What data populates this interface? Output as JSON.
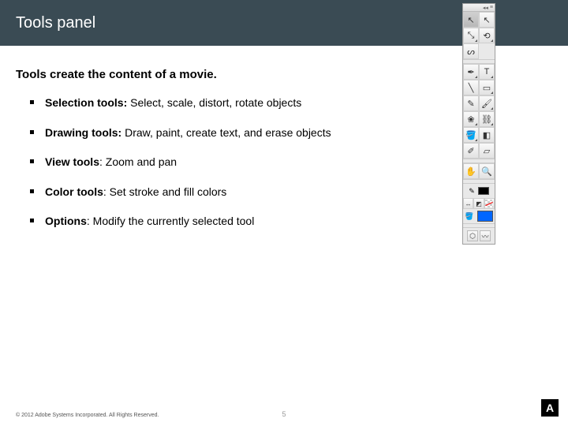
{
  "header": {
    "title": "Tools panel"
  },
  "intro": "Tools create the content of a movie.",
  "bullets": [
    {
      "label": "Selection tools:",
      "desc": " Select, scale, distort, rotate objects"
    },
    {
      "label": "Drawing tools:",
      "desc": " Draw, paint, create text, and erase objects"
    },
    {
      "label": "View tools",
      "desc": ": Zoom and pan"
    },
    {
      "label": "Color tools",
      "desc": ": Set stroke and fill colors"
    },
    {
      "label": "Options",
      "desc": ": Modify the currently selected tool"
    }
  ],
  "footer": {
    "copyright": "© 2012 Adobe Systems Incorporated. All Rights Reserved.",
    "page": "5",
    "logo": "A"
  },
  "tools": {
    "grip": {
      "collapse": "◂◂",
      "menu": "≡"
    },
    "items": [
      {
        "name": "selection-tool",
        "glyph": "↖",
        "active": true
      },
      {
        "name": "subselection-tool",
        "glyph": "↖"
      },
      {
        "name": "free-transform-tool",
        "glyph": "⤡",
        "corner": true
      },
      {
        "name": "3d-rotation-tool",
        "glyph": "⟲",
        "corner": true
      },
      {
        "name": "lasso-tool",
        "glyph": "ᔕ"
      },
      {
        "name": "pen-tool",
        "glyph": "✒",
        "corner": true
      },
      {
        "name": "text-tool",
        "glyph": "T",
        "corner": true
      },
      {
        "name": "line-tool",
        "glyph": "╲"
      },
      {
        "name": "rectangle-tool",
        "glyph": "▭",
        "corner": true
      },
      {
        "name": "pencil-tool",
        "glyph": "✎"
      },
      {
        "name": "brush-tool",
        "glyph": "🖌",
        "corner": true
      },
      {
        "name": "deco-tool",
        "glyph": "❀",
        "corner": true
      },
      {
        "name": "bone-tool",
        "glyph": "⛓",
        "corner": true
      },
      {
        "name": "paint-bucket-tool",
        "glyph": "🪣",
        "corner": true
      },
      {
        "name": "ink-bottle-tool",
        "glyph": "◧"
      },
      {
        "name": "eyedropper-tool",
        "glyph": "✐"
      },
      {
        "name": "eraser-tool",
        "glyph": "▱"
      },
      {
        "name": "hand-tool",
        "glyph": "✋"
      },
      {
        "name": "zoom-tool",
        "glyph": "🔍"
      }
    ],
    "stroke_swap": [
      {
        "name": "swap-colors-icon",
        "glyph": "↔"
      },
      {
        "name": "default-colors-icon",
        "glyph": "◩"
      }
    ],
    "options": [
      {
        "name": "snap-option",
        "glyph": "⬡"
      },
      {
        "name": "smooth-option",
        "glyph": "〰"
      }
    ]
  }
}
